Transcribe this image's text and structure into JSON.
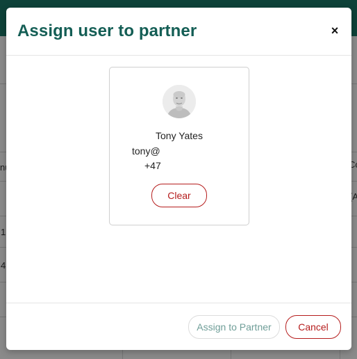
{
  "modal": {
    "title": "Assign user to partner",
    "close_label": "×"
  },
  "user_card": {
    "name": "Tony Yates",
    "email": "tony@",
    "phone": "+47",
    "clear_label": "Clear"
  },
  "footer": {
    "assign_label": "Assign to Partner",
    "cancel_label": "Cancel"
  },
  "background": {
    "fragments": [
      "nu",
      "1",
      "4",
      "Co",
      "(A"
    ]
  },
  "colors": {
    "title": "#145e55",
    "topbar": "#1b7a6a",
    "danger": "#b51c1c",
    "assign_disabled_text": "#6f9e98"
  }
}
